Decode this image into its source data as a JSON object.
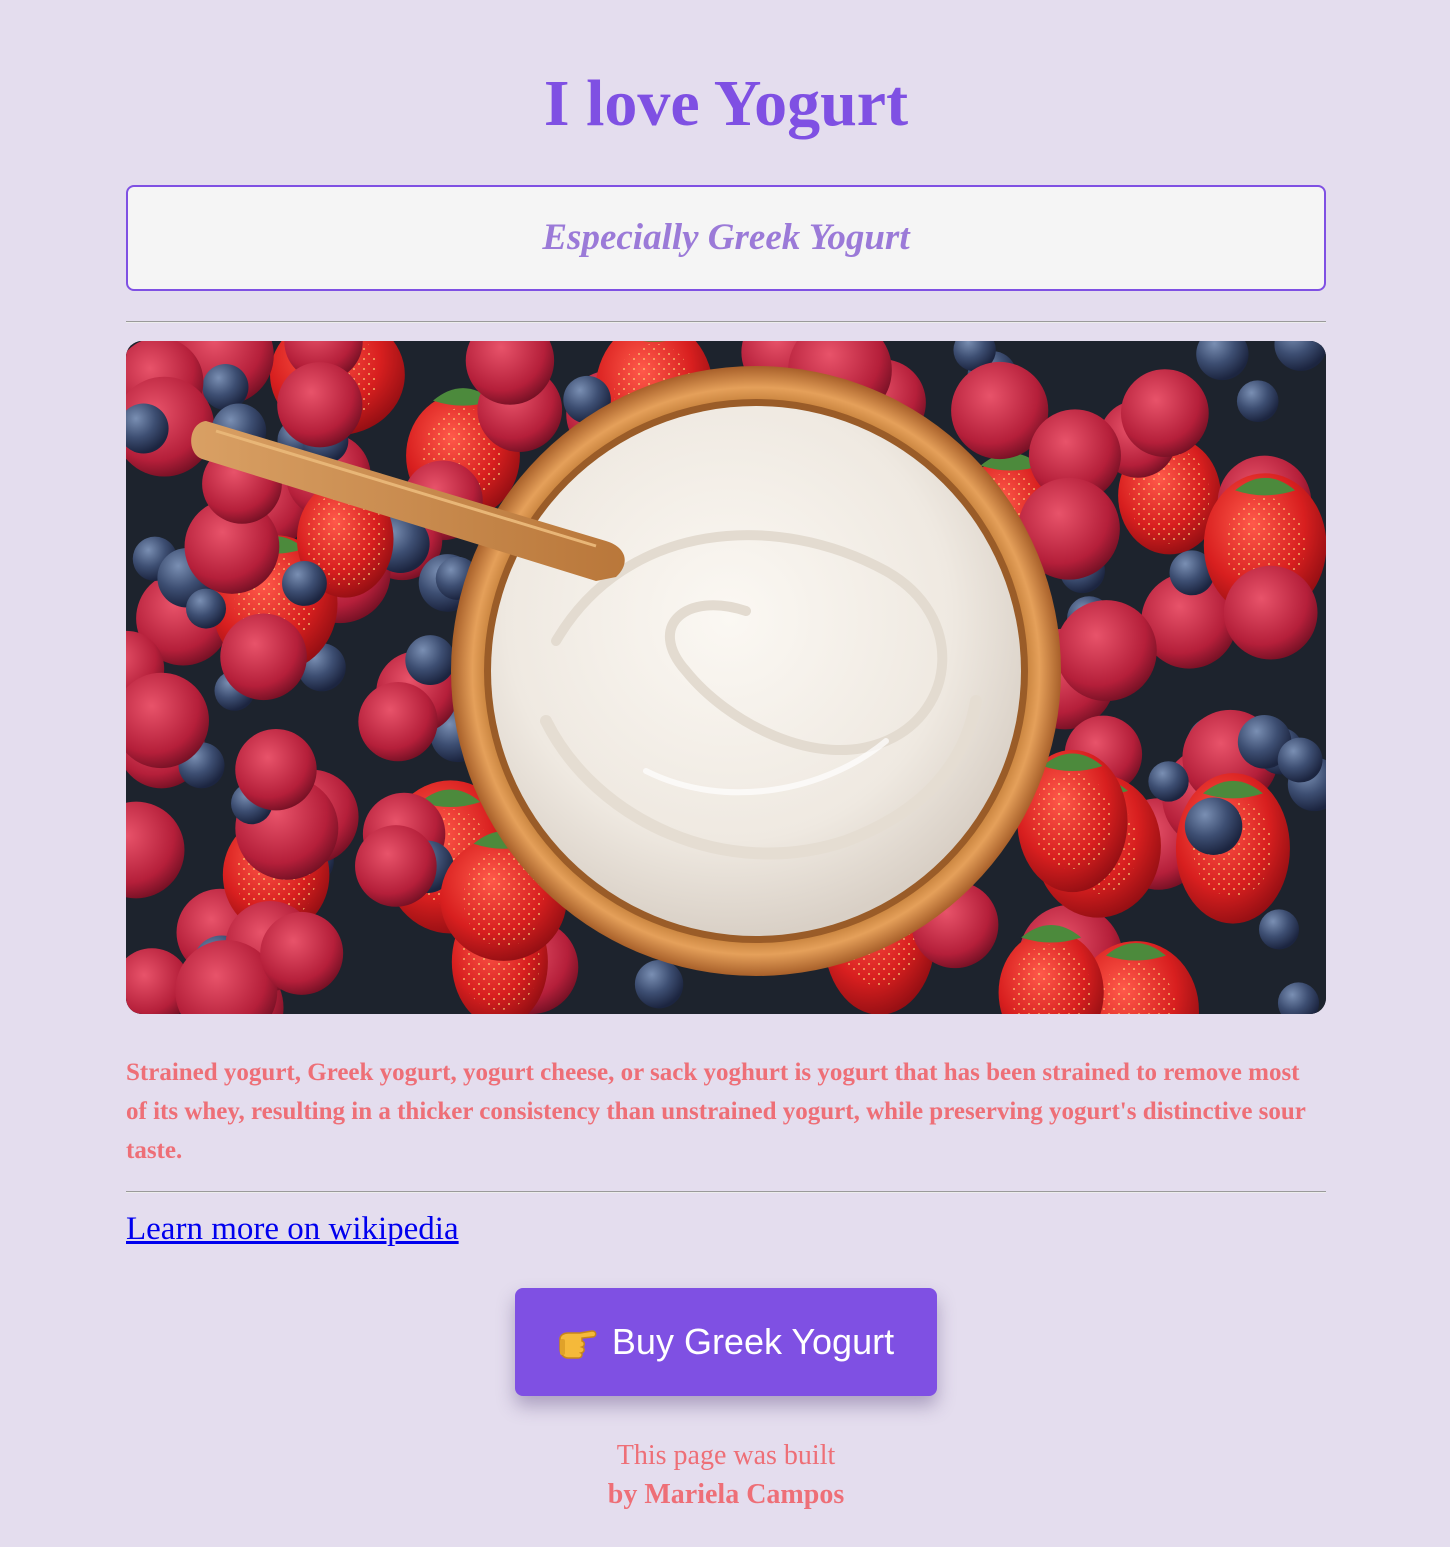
{
  "header": {
    "title": "I love Yogurt",
    "subtitle": "Especially Greek Yogurt"
  },
  "hero_image": {
    "description_alt": "Bowl of Greek yogurt with a wooden spoon, surrounded by strawberries, raspberries and blueberries"
  },
  "main": {
    "description": "Strained yogurt, Greek yogurt, yogurt cheese, or sack yoghurt is yogurt that has been strained to remove most of its whey, resulting in a thicker consistency than unstrained yogurt, while preserving yogurt's distinctive sour taste.",
    "link_label": "Learn more on wikipedia",
    "buy_label": "Buy Greek Yogurt",
    "buy_icon": "pointing-hand-icon"
  },
  "footer": {
    "line": "This page was built",
    "author": "by Mariela Campos"
  },
  "colors": {
    "background": "#e4ddee",
    "accent": "#7f50e3",
    "subtitle": "#9b7ad8",
    "text_coral": "#ee6f77",
    "link": "#0000ee"
  }
}
